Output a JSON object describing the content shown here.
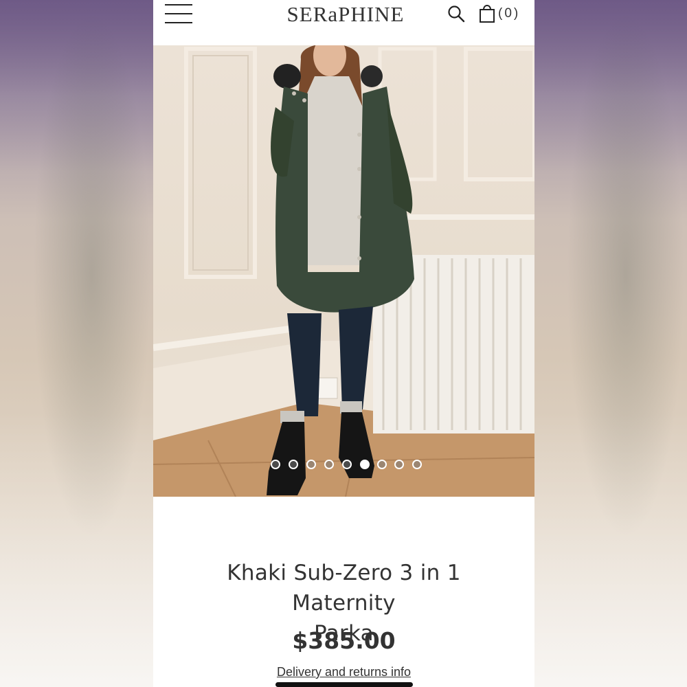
{
  "header": {
    "brand": "SERaPHINE",
    "cart_count": "(0)",
    "icons": {
      "menu": "hamburger-menu-icon",
      "search": "search-icon",
      "cart": "shopping-bag-icon"
    }
  },
  "gallery": {
    "image": "woman-in-khaki-parka-photo",
    "slide_count": 9,
    "active_slide": 6
  },
  "product": {
    "title_line1": "Khaki Sub-Zero 3 in 1 Maternity",
    "title_line2": "Parka",
    "price": "$385.00",
    "delivery_link": "Delivery and returns info"
  },
  "colors": {
    "parka_khaki": "#3b4a3c",
    "text": "#333333",
    "background": "#ffffff"
  }
}
